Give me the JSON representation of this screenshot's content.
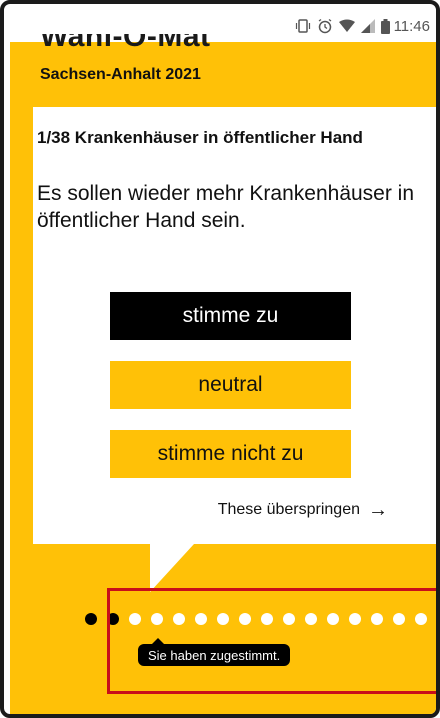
{
  "status_bar": {
    "time": "11:46",
    "icons": [
      "vibrate-icon",
      "alarm-icon",
      "wifi-icon",
      "signal-icon",
      "battery-icon"
    ]
  },
  "header": {
    "brand": "Wahl-O-Mat",
    "subtitle": "Sachsen-Anhalt 2021"
  },
  "thesis": {
    "title": "1/38 Krankenhäuser in öffentlicher Hand",
    "text": "Es sollen wieder mehr Krankenhäuser in öffentlicher Hand sein."
  },
  "buttons": {
    "agree": "stimme zu",
    "neutral": "neutral",
    "disagree": "stimme nicht zu"
  },
  "skip": {
    "label": "These überspringen",
    "arrow": "→"
  },
  "progress": {
    "answered_count": 2,
    "total": 38,
    "tooltip": "Sie haben zugestimmt."
  },
  "colors": {
    "brand_yellow": "#ffc107",
    "highlight_red": "#c80e1a",
    "black": "#000000"
  }
}
